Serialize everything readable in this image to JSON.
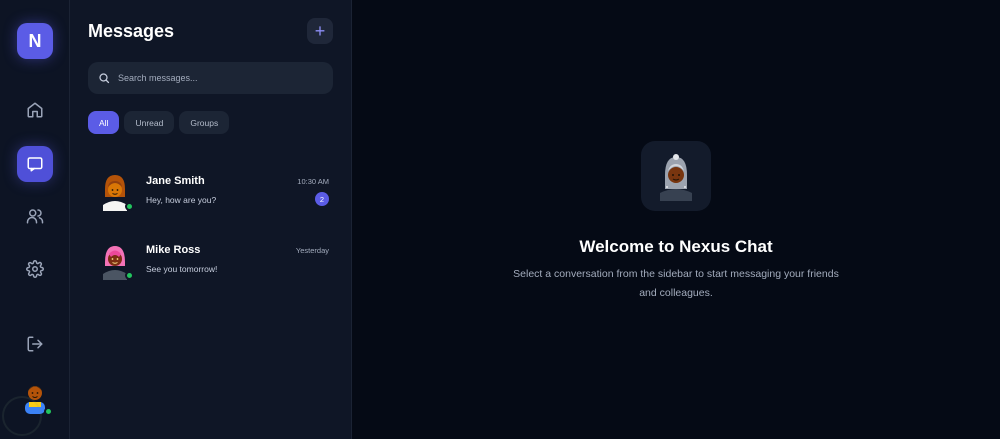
{
  "app": {
    "logo_letter": "N"
  },
  "rail": {
    "items": [
      {
        "icon": "home-icon"
      },
      {
        "icon": "chat-icon",
        "active": true
      },
      {
        "icon": "users-icon"
      },
      {
        "icon": "gear-icon"
      }
    ],
    "logout_icon": "logout-icon"
  },
  "sidebar": {
    "title": "Messages",
    "new_button": "+",
    "search": {
      "placeholder": "Search messages..."
    },
    "filters": [
      "All",
      "Unread",
      "Groups"
    ],
    "active_filter": "All",
    "conversations": [
      {
        "name": "Jane Smith",
        "time": "10:30 AM",
        "preview": "Hey, how are you?",
        "unread": "2",
        "online": true
      },
      {
        "name": "Mike Ross",
        "time": "Yesterday",
        "preview": "See you tomorrow!",
        "online": true
      }
    ]
  },
  "main": {
    "welcome_title": "Welcome to Nexus Chat",
    "welcome_text": "Select a conversation from the sidebar to start messaging your friends and colleagues."
  },
  "colors": {
    "accent": "#5b5ce6",
    "online": "#22c55e",
    "background": "#050a15",
    "sidebar": "#0f1626"
  }
}
